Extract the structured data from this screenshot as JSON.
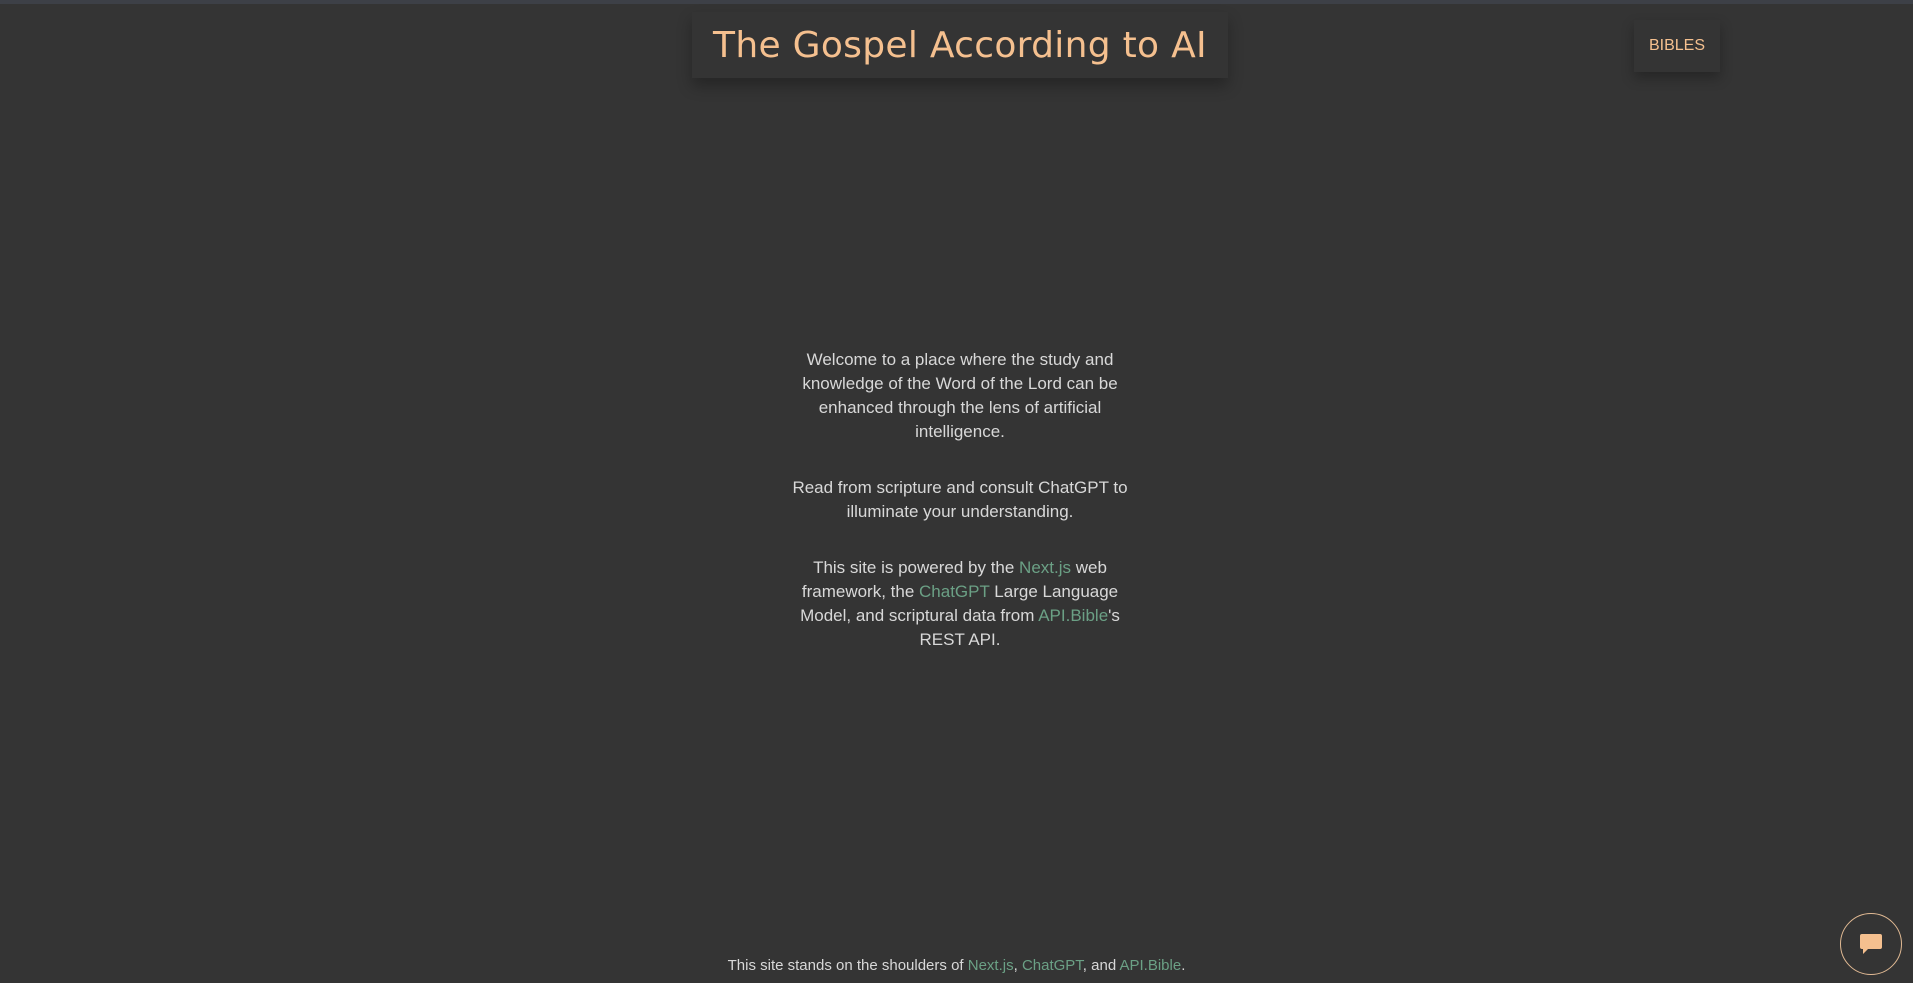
{
  "header": {
    "title": "The Gospel According to AI",
    "nav_label": "BIBLES"
  },
  "intro": {
    "p1": "Welcome to a place where the study and knowledge of the Word of the Lord can be enhanced through the lens of artificial intelligence.",
    "p2": "Read from scripture and consult ChatGPT to illuminate your understanding.",
    "p3": {
      "t1": "This site is powered by the ",
      "link1": "Next.js",
      "t2": " web framework, the ",
      "link2": "ChatGPT",
      "t3": " Large Language Model, and scriptural data from ",
      "link3": "API.Bible",
      "t4": "'s REST API."
    }
  },
  "footer": {
    "t1": "This site stands on the shoulders of ",
    "link1": "Next.js",
    "t2": ", ",
    "link2": "ChatGPT",
    "t3": ", and ",
    "link3": "API.Bible",
    "t4": "."
  },
  "chat": {
    "icon": "chat-bubble-icon"
  },
  "colors": {
    "background": "#343434",
    "accent": "#f5c08f",
    "link": "#6ba085",
    "text": "#d8d8d8"
  }
}
